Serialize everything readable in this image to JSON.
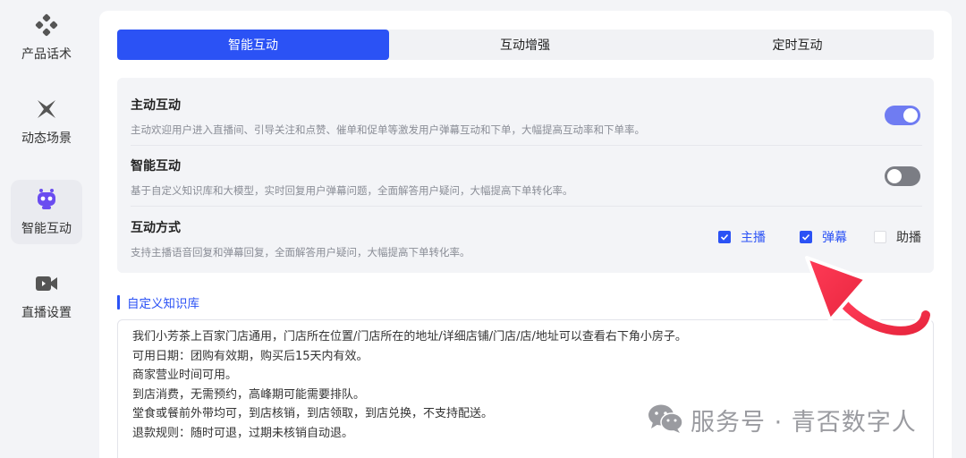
{
  "sidebar": {
    "items": [
      {
        "label": "产品话术",
        "icon": "product-script-icon",
        "active": false
      },
      {
        "label": "动态场景",
        "icon": "dynamic-scene-icon",
        "active": false
      },
      {
        "label": "智能互动",
        "icon": "robot-icon",
        "active": true
      },
      {
        "label": "直播设置",
        "icon": "video-camera-icon",
        "active": false
      }
    ]
  },
  "tabs": [
    {
      "label": "智能互动",
      "active": true
    },
    {
      "label": "互动增强",
      "active": false
    },
    {
      "label": "定时互动",
      "active": false
    }
  ],
  "settings": {
    "active_interaction": {
      "title": "主动互动",
      "desc": "主动欢迎用户进入直播间、引导关注和点赞、催单和促单等激发用户弹幕互动和下单，大幅提高互动率和下单率。",
      "enabled": true
    },
    "smart_interaction": {
      "title": "智能互动",
      "desc": "基于自定义知识库和大模型，实时回复用户弹幕问题，全面解答用户疑问，大幅提高下单转化率。",
      "enabled": false
    },
    "interaction_mode": {
      "title": "互动方式",
      "desc": "支持主播语音回复和弹幕回复，全面解答用户疑问，大幅提高下单转化率。",
      "options": [
        {
          "label": "主播",
          "checked": true
        },
        {
          "label": "弹幕",
          "checked": true
        },
        {
          "label": "助播",
          "checked": false
        }
      ]
    }
  },
  "knowledge_base": {
    "title": "自定义知识库",
    "lines": [
      "我们小芳茶上百家门店通用，门店所在位置/门店所在的地址/详细店铺/门店/店/地址可以查看右下角小房子。",
      "可用日期：团购有效期，购买后15天内有效。",
      "商家营业时间可用。",
      "到店消费，无需预约，高峰期可能需要排队。",
      "堂食或餐前外带均可，到店核销，到店领取，到店兑换，不支持配送。",
      "退款规则：随时可退，过期未核销自动退。"
    ]
  },
  "watermark": {
    "text": "服务号 · 青否数字人",
    "icon": "wechat-icon"
  },
  "colors": {
    "accent": "#2b52f5",
    "toggle_on": "#6f7cf2",
    "toggle_off": "#7b7d84",
    "arrow": "#f0314a"
  }
}
